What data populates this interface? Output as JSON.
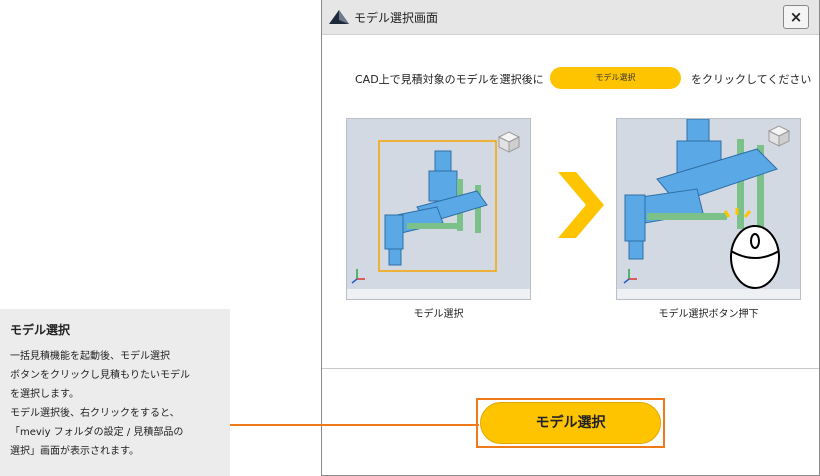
{
  "window": {
    "title": "モデル選択画面",
    "close_label": "×"
  },
  "instruction": {
    "before": "CAD上で見積対象のモデルを選択後に",
    "pill_label": "モデル選択",
    "after": "をクリックしてください"
  },
  "steps": [
    {
      "caption": "モデル選択"
    },
    {
      "caption": "モデル選択ボタン押下"
    }
  ],
  "action_button": {
    "label": "モデル選択"
  },
  "annotation": {
    "title": "モデル選択",
    "body": "一括見積機能を起動後、モデル選択\nボタンをクリックし見積もりたいモデル\nを選択します。\nモデル選択後、右クリックをすると、\n「meviy フォルダの設定 / 見積部品の\n選択」画面が表示されます。"
  },
  "colors": {
    "accent_yellow": "#ffc400",
    "highlight_orange": "#ef7a1a",
    "model_blue": "#5aa9e6",
    "model_green": "#7cc08a"
  }
}
